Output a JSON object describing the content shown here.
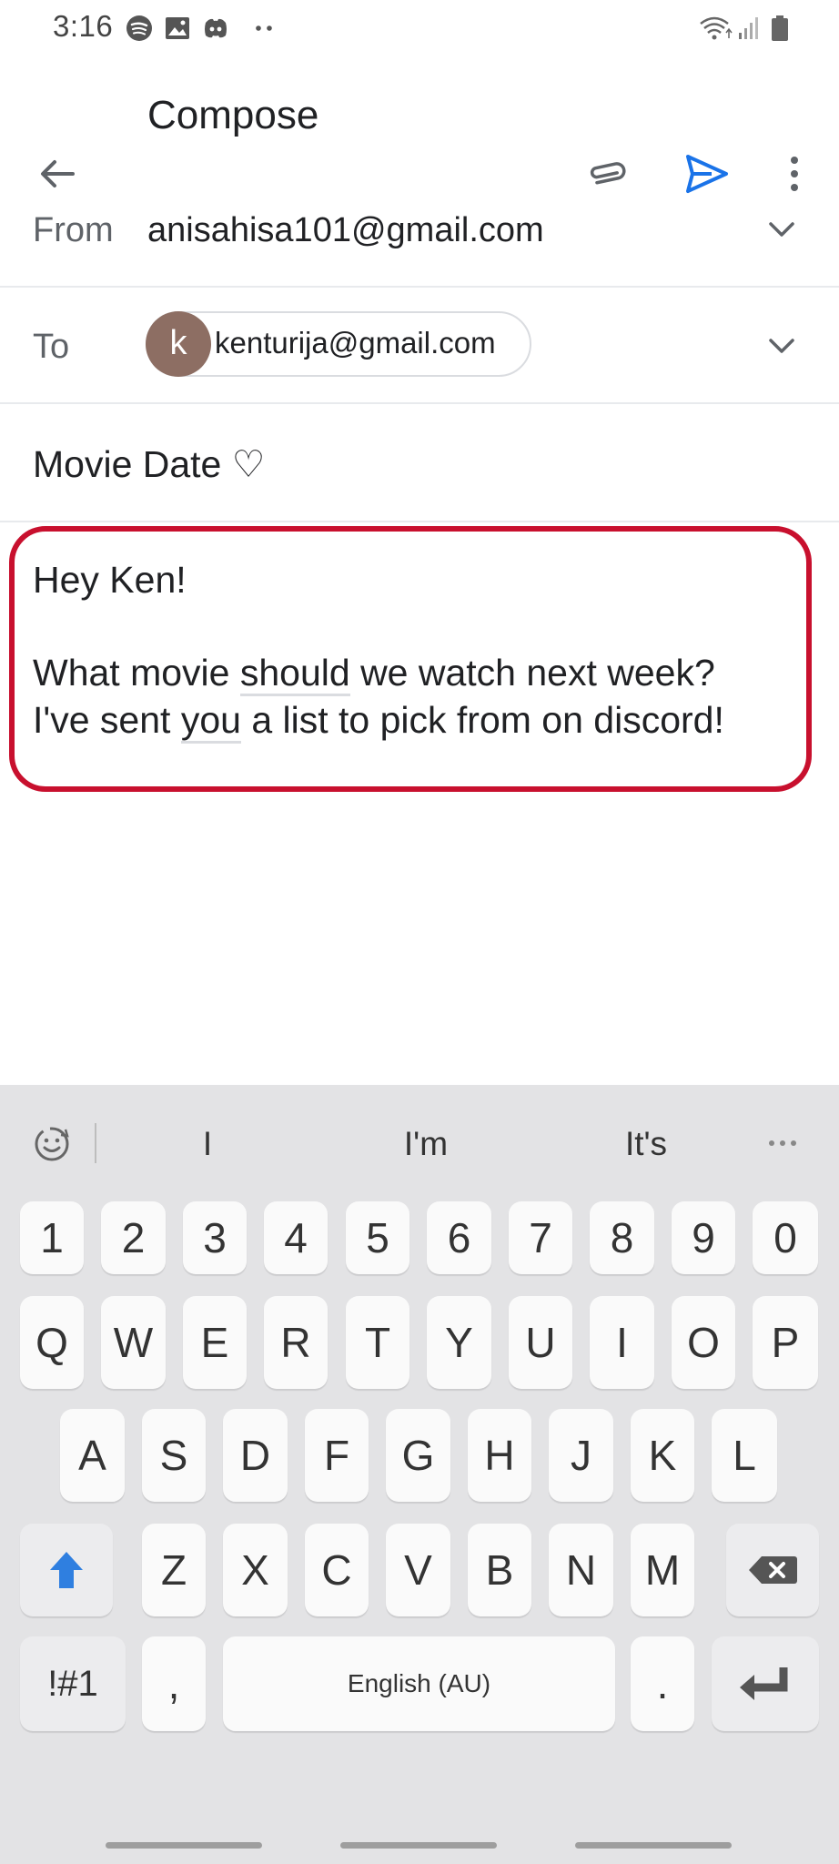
{
  "status_bar": {
    "time": "3:16",
    "left_icons": [
      "spotify-icon",
      "gallery-icon",
      "discord-icon",
      "more-notifications-icon"
    ],
    "right_icons": [
      "wifi-icon",
      "signal-icon",
      "battery-icon"
    ]
  },
  "app_bar": {
    "title": "Compose",
    "back_icon": "arrow-left-icon",
    "attach_icon": "paperclip-icon",
    "send_icon": "send-icon",
    "more_icon": "more-vert-icon",
    "accent_color": "#1a73e8"
  },
  "compose": {
    "from_label": "From",
    "from_value": "anisahisa101@gmail.com",
    "to_label": "To",
    "to_chip": {
      "initial": "k",
      "email": "kenturija@gmail.com",
      "avatar_color": "#8d6e63"
    },
    "subject": "Movie Date ♡",
    "body": {
      "line1": "Hey Ken!",
      "line2a": "What movie ",
      "line2b": "should",
      "line2c": " we watch next week?",
      "line3a": "I've sent ",
      "line3b": "you",
      "line3c": " a list to pick from on discord!"
    },
    "highlight_color": "#c8102e"
  },
  "keyboard": {
    "suggestions": [
      "I",
      "I'm",
      "It's"
    ],
    "number_row": [
      "1",
      "2",
      "3",
      "4",
      "5",
      "6",
      "7",
      "8",
      "9",
      "0"
    ],
    "row1": [
      "Q",
      "W",
      "E",
      "R",
      "T",
      "Y",
      "U",
      "I",
      "O",
      "P"
    ],
    "row2": [
      "A",
      "S",
      "D",
      "F",
      "G",
      "H",
      "J",
      "K",
      "L"
    ],
    "row3": [
      "Z",
      "X",
      "C",
      "V",
      "B",
      "N",
      "M"
    ],
    "symbols_label": "!#1",
    "comma_label": ",",
    "space_label": "English (AU)",
    "period_label": ".",
    "shift_color": "#2f7fe0"
  }
}
